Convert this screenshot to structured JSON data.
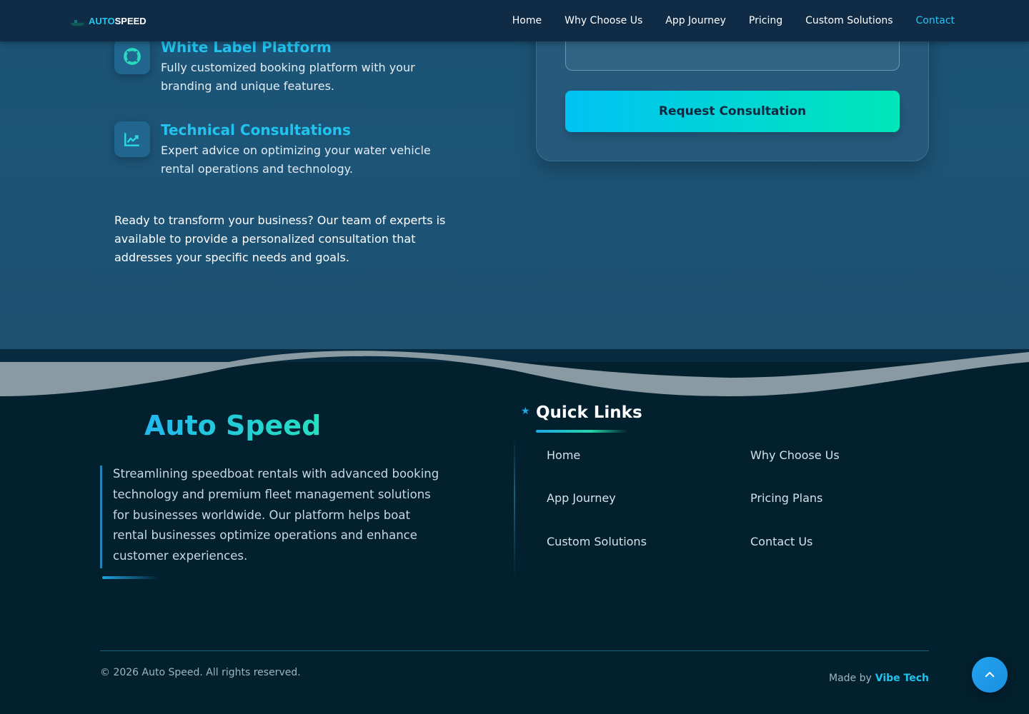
{
  "brand": {
    "logo_part1": "AUTO",
    "logo_part2": "SPEED"
  },
  "nav": {
    "items": [
      {
        "label": "Home"
      },
      {
        "label": "Why Choose Us"
      },
      {
        "label": "App Journey"
      },
      {
        "label": "Pricing"
      },
      {
        "label": "Custom Solutions"
      },
      {
        "label": "Contact",
        "active": true
      }
    ]
  },
  "features": [
    {
      "icon": "lifebuoy-icon",
      "title": "White Label Platform",
      "description": "Fully customized booking platform with your branding and unique features."
    },
    {
      "icon": "chart-line-icon",
      "title": "Technical Consultations",
      "description": "Expert advice on optimizing your water vehicle rental operations and technology."
    }
  ],
  "cta_text": "Ready to transform your business? Our team of experts is available to provide a personalized consultation that addresses your specific needs and goals.",
  "form": {
    "message_value": "",
    "submit_label": "Request Consultation"
  },
  "footer": {
    "brand_name": "Auto Speed",
    "description": "Streamlining speedboat rentals with advanced booking technology and premium fleet management solutions for businesses worldwide. Our platform helps boat rental businesses optimize operations and enhance customer experiences.",
    "quick_links_title": "Quick Links",
    "quick_links": [
      {
        "label": "Home"
      },
      {
        "label": "Why Choose Us"
      },
      {
        "label": "App Journey"
      },
      {
        "label": "Pricing Plans"
      },
      {
        "label": "Custom Solutions"
      },
      {
        "label": "Contact Us"
      }
    ],
    "copyright": "© 2026 Auto Speed. All rights reserved.",
    "made_by_prefix": "Made by",
    "made_by_name": "Vibe Tech"
  },
  "colors": {
    "accent": "#22c3ee",
    "accent_green": "#00e7b8",
    "nav_bg": "#0f2b45",
    "footer_bg": "#03202f"
  }
}
